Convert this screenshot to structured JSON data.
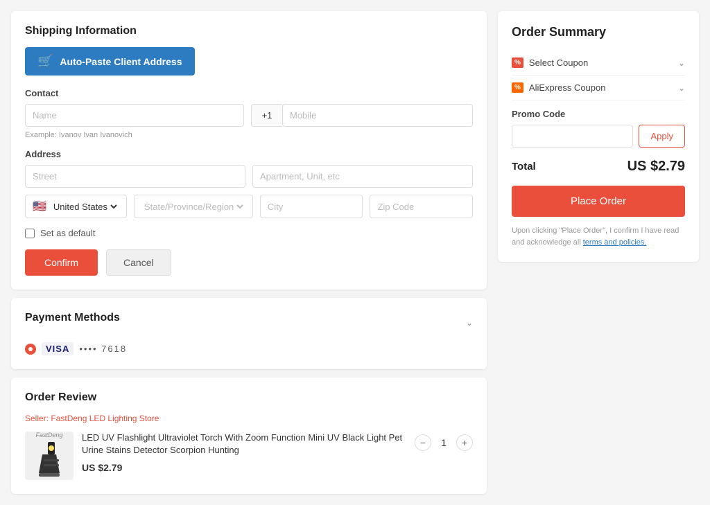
{
  "page": {
    "shipping_title": "Shipping Information",
    "auto_paste_label": "Auto-Paste Client Address",
    "contact_label": "Contact",
    "name_placeholder": "Name",
    "country_code": "+1",
    "mobile_placeholder": "Mobile",
    "example_text": "Example: Ivanov Ivan Ivanovich",
    "address_label": "Address",
    "street_placeholder": "Street",
    "apt_placeholder": "Apartment, Unit, etc",
    "country_value": "United States",
    "state_placeholder": "State/Province/Region",
    "city_placeholder": "City",
    "zip_placeholder": "Zip Code",
    "set_default_label": "Set as default",
    "confirm_label": "Confirm",
    "cancel_label": "Cancel"
  },
  "payment": {
    "title": "Payment Methods",
    "visa_label": "VISA",
    "visa_dots": "•••• 7618"
  },
  "order_review": {
    "title": "Order Review",
    "seller_prefix": "Seller: ",
    "seller_name": "FastDeng LED Lighting Store",
    "product_title": "LED UV Flashlight Ultraviolet Torch With Zoom Function Mini UV Black Light Pet Urine Stains Detector Scorpion Hunting",
    "product_price": "US $2.79",
    "qty": 1
  },
  "order_summary": {
    "title": "Order Summary",
    "select_coupon_label": "Select Coupon",
    "aliexpress_coupon_label": "AliExpress Coupon",
    "promo_code_label": "Promo Code",
    "promo_placeholder": "",
    "apply_label": "Apply",
    "total_label": "Total",
    "total_value": "US $2.79",
    "place_order_label": "Place Order",
    "terms_text": "Upon clicking \"Place Order\", I confirm I have read and acknowledge all ",
    "terms_link_text": "terms and policies."
  }
}
